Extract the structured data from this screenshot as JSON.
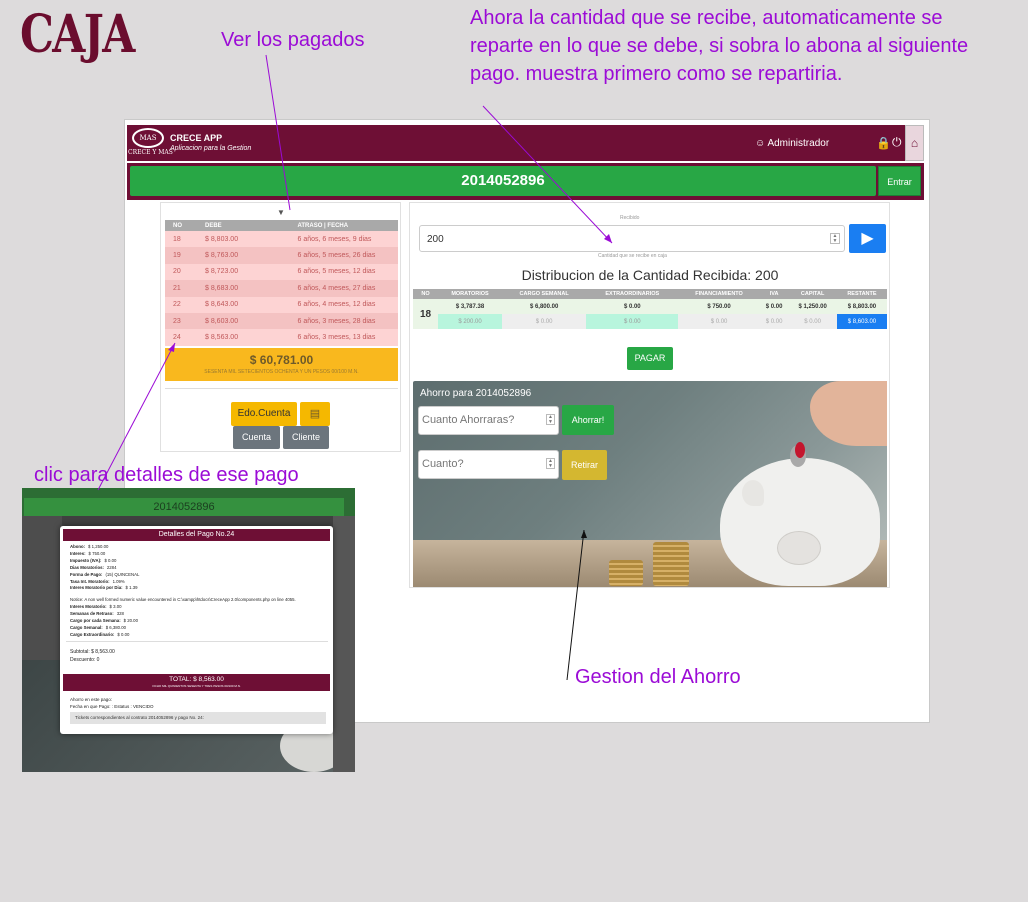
{
  "annotations": {
    "caja": "CAJA",
    "ver_pagados": "Ver los pagados",
    "reparto": "Ahora la cantidad que se recibe, automaticamente se reparte en lo que se debe, si sobra lo abona al siguiente pago. muestra primero como se repartiria.",
    "clic_detalles": "clic para detalles de ese pago",
    "gestion_ahorro": "Gestion del Ahorro"
  },
  "navbar": {
    "logo_text": "MAS",
    "logo_sub": "CRECE Y MAS",
    "app_name": "CRECE APP",
    "app_sub": "Aplicacion para la Gestion",
    "user": "Administrador",
    "user_icon": "user-icon",
    "lock_icon": "lock-icon",
    "power_icon": "power-icon",
    "home_icon": "home-icon"
  },
  "contract": {
    "number": "2014052896",
    "entrar_label": "Entrar"
  },
  "payments": {
    "headers": [
      "NO",
      "DEBE",
      "ATRASO | FECHA"
    ],
    "rows": [
      {
        "no": "18",
        "debe": "$ 8,803.00",
        "atraso": "6 años, 6 meses, 9 dias"
      },
      {
        "no": "19",
        "debe": "$ 8,763.00",
        "atraso": "6 años, 5 meses, 26 dias"
      },
      {
        "no": "20",
        "debe": "$ 8,723.00",
        "atraso": "6 años, 5 meses, 12 dias"
      },
      {
        "no": "21",
        "debe": "$ 8,683.00",
        "atraso": "6 años, 4 meses, 27 dias"
      },
      {
        "no": "22",
        "debe": "$ 8,643.00",
        "atraso": "6 años, 4 meses, 12 dias"
      },
      {
        "no": "23",
        "debe": "$ 8,603.00",
        "atraso": "6 años, 3 meses, 28 dias"
      },
      {
        "no": "24",
        "debe": "$ 8,563.00",
        "atraso": "6 años, 3 meses, 13 dias"
      }
    ],
    "total": "$ 60,781.00",
    "total_words": "SESENTA MIL SETECIENTOS OCHENTA Y UN PESOS 00/100 M.N.",
    "edo_cuenta_label": "Edo.Cuenta",
    "doc_icon": "document-icon",
    "cuenta_label": "Cuenta",
    "cliente_label": "Cliente"
  },
  "recibido": {
    "label": "Recibido",
    "value": "200",
    "hint": "Cantidad que se recibe en caja",
    "go_icon": "play-icon"
  },
  "distribucion": {
    "title": "Distribucion de la Cantidad Recibida: 200",
    "headers": [
      "NO",
      "MORATORIOS",
      "CARGO SEMANAL",
      "EXTRAORDINARIOS",
      "FINANCIAMIENTO",
      "IVA",
      "CAPITAL",
      "RESTANTE"
    ],
    "no": "18",
    "values": [
      "$ 3,787.38",
      "$ 6,800.00",
      "$ 0.00",
      "$ 750.00",
      "$ 0.00",
      "$ 1,250.00",
      "$ 8,803.00"
    ],
    "parts": [
      "$ 200.00",
      "$ 0.00",
      "$ 0.00",
      "$ 0.00",
      "$ 0.00",
      "$ 0.00",
      "$ 8,603.00"
    ],
    "pagar_label": "PAGAR"
  },
  "ahorro": {
    "title": "Ahorro para 2014052896",
    "ahorrar_placeholder": "Cuanto Ahorraras?",
    "ahorrar_label": "Ahorrar!",
    "retirar_placeholder": "Cuanto?",
    "retirar_label": "Retirar"
  },
  "detalle": {
    "contract": "2014052896",
    "header": "Detalles del Pago No.24",
    "lines": [
      [
        "Abono:",
        "$ 1,250.00"
      ],
      [
        "Interes:",
        "$ 750.00"
      ],
      [
        "Impuesto (IVA):",
        "$ 0.00"
      ],
      [
        "Dias Moratorios:",
        "2284"
      ],
      [
        "Forma de Pago:",
        "(15) QUINCENAL"
      ],
      [
        "Tasa Int. Moratorio:",
        "1.09%"
      ],
      [
        "Interes Moratorio por Dia:",
        "$ 1.39"
      ]
    ],
    "notice": "Notice: A non well formed numeric value encountered in C:\\xampp\\htdocs\\CreceApp 2.0\\components.php on line 4055.",
    "lines2": [
      [
        "Interes Moratorio:",
        "$ 3.00"
      ],
      [
        "Semanas de Retraso:",
        "328"
      ],
      [
        "Cargo por cada Semana:",
        "$ 20.00"
      ],
      [
        "Cargo Semanal:",
        "$ 6,380.00"
      ],
      [
        "Cargo Extraordinario:",
        "$ 0.00"
      ]
    ],
    "subtotal": "Subtotal: $ 8,563.00",
    "descuento": "Descuento: 0",
    "total": "TOTAL: $ 8,563.00",
    "total_words": "OCHO MIL QUINIENTOS SESENTA Y TRES PESOS 00/100 M.N.",
    "ahorro_pago": "Ahorro en este pago:",
    "fecha_pago": "Fecha en que Pago: : Estatus : VENCIDO",
    "ticket": "Tickets correspondientes al contrato 2014052896 y pago No. 24:"
  },
  "colors": {
    "brand": "#6e0f35",
    "green": "#28a745",
    "blue": "#1a7ef2",
    "yellow": "#f5b800",
    "annotation": "#9b0bd6"
  }
}
